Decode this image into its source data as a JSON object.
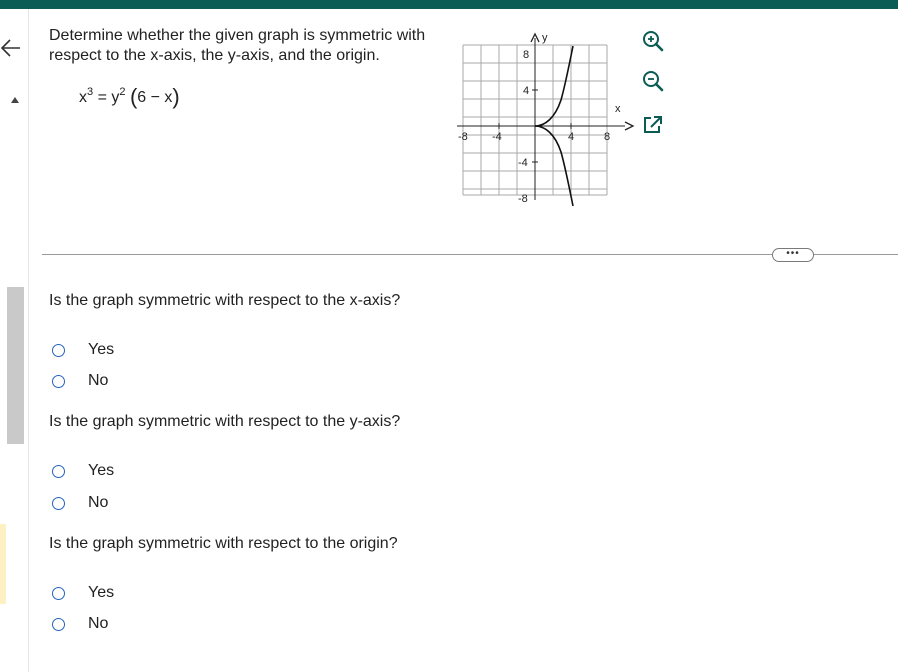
{
  "problem": {
    "text": "Determine whether the given graph is symmetric with respect to the x-axis, the y-axis, and the origin.",
    "equation": {
      "lhs_base": "x",
      "lhs_exp": "3",
      "eq": "=",
      "rhs_base": "y",
      "rhs_exp": "2",
      "factor": "6 − x"
    }
  },
  "graph": {
    "x_label": "x",
    "y_label": "y",
    "x_ticks": [
      "-8",
      "-4",
      "4",
      "8"
    ],
    "y_ticks": [
      "8",
      "4",
      "-4",
      "-8"
    ]
  },
  "toolbar": {
    "zoom_in_icon": "zoom-in-icon",
    "zoom_out_icon": "zoom-out-icon",
    "popout_icon": "external-link-icon",
    "more_label": "•••"
  },
  "questions": [
    {
      "text": "Is the graph symmetric with respect to the x-axis?",
      "options": [
        "Yes",
        "No"
      ]
    },
    {
      "text": "Is the graph symmetric with respect to the y-axis?",
      "options": [
        "Yes",
        "No"
      ]
    },
    {
      "text": "Is the graph symmetric with respect to the origin?",
      "options": [
        "Yes",
        "No"
      ]
    }
  ],
  "colors": {
    "topbar": "#0b5c55",
    "radio": "#2563c0",
    "icon": "#0b5c55"
  }
}
